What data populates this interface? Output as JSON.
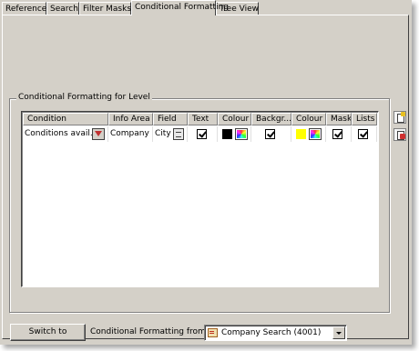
{
  "tabs": [
    "Reference",
    "Search",
    "Filter Masks",
    "Conditional Formatting",
    "Tree View"
  ],
  "group": {
    "title": "Conditional Formatting for Level"
  },
  "table": {
    "headers": [
      "Condition",
      "Info Area",
      "Field",
      "Text",
      "Colour",
      "Backgr...",
      "Colour",
      "Mask",
      "Lists"
    ],
    "rows": [
      {
        "condition": "Conditions avail...",
        "info_area": "Company",
        "field": "City",
        "text_checked": true,
        "text_colour": "#000000",
        "background_checked": true,
        "background_colour": "#ffff00",
        "mask_checked": true,
        "lists_checked": true
      }
    ]
  },
  "footer": {
    "switch_label": "Switch to",
    "level_label": "Conditional Formatting from Level",
    "level_value": "Company Search (4001)"
  },
  "icons": {
    "add": "add-format-icon",
    "delete": "delete-format-icon",
    "filter": "filter-icon",
    "palette": "colour-palette-icon"
  }
}
